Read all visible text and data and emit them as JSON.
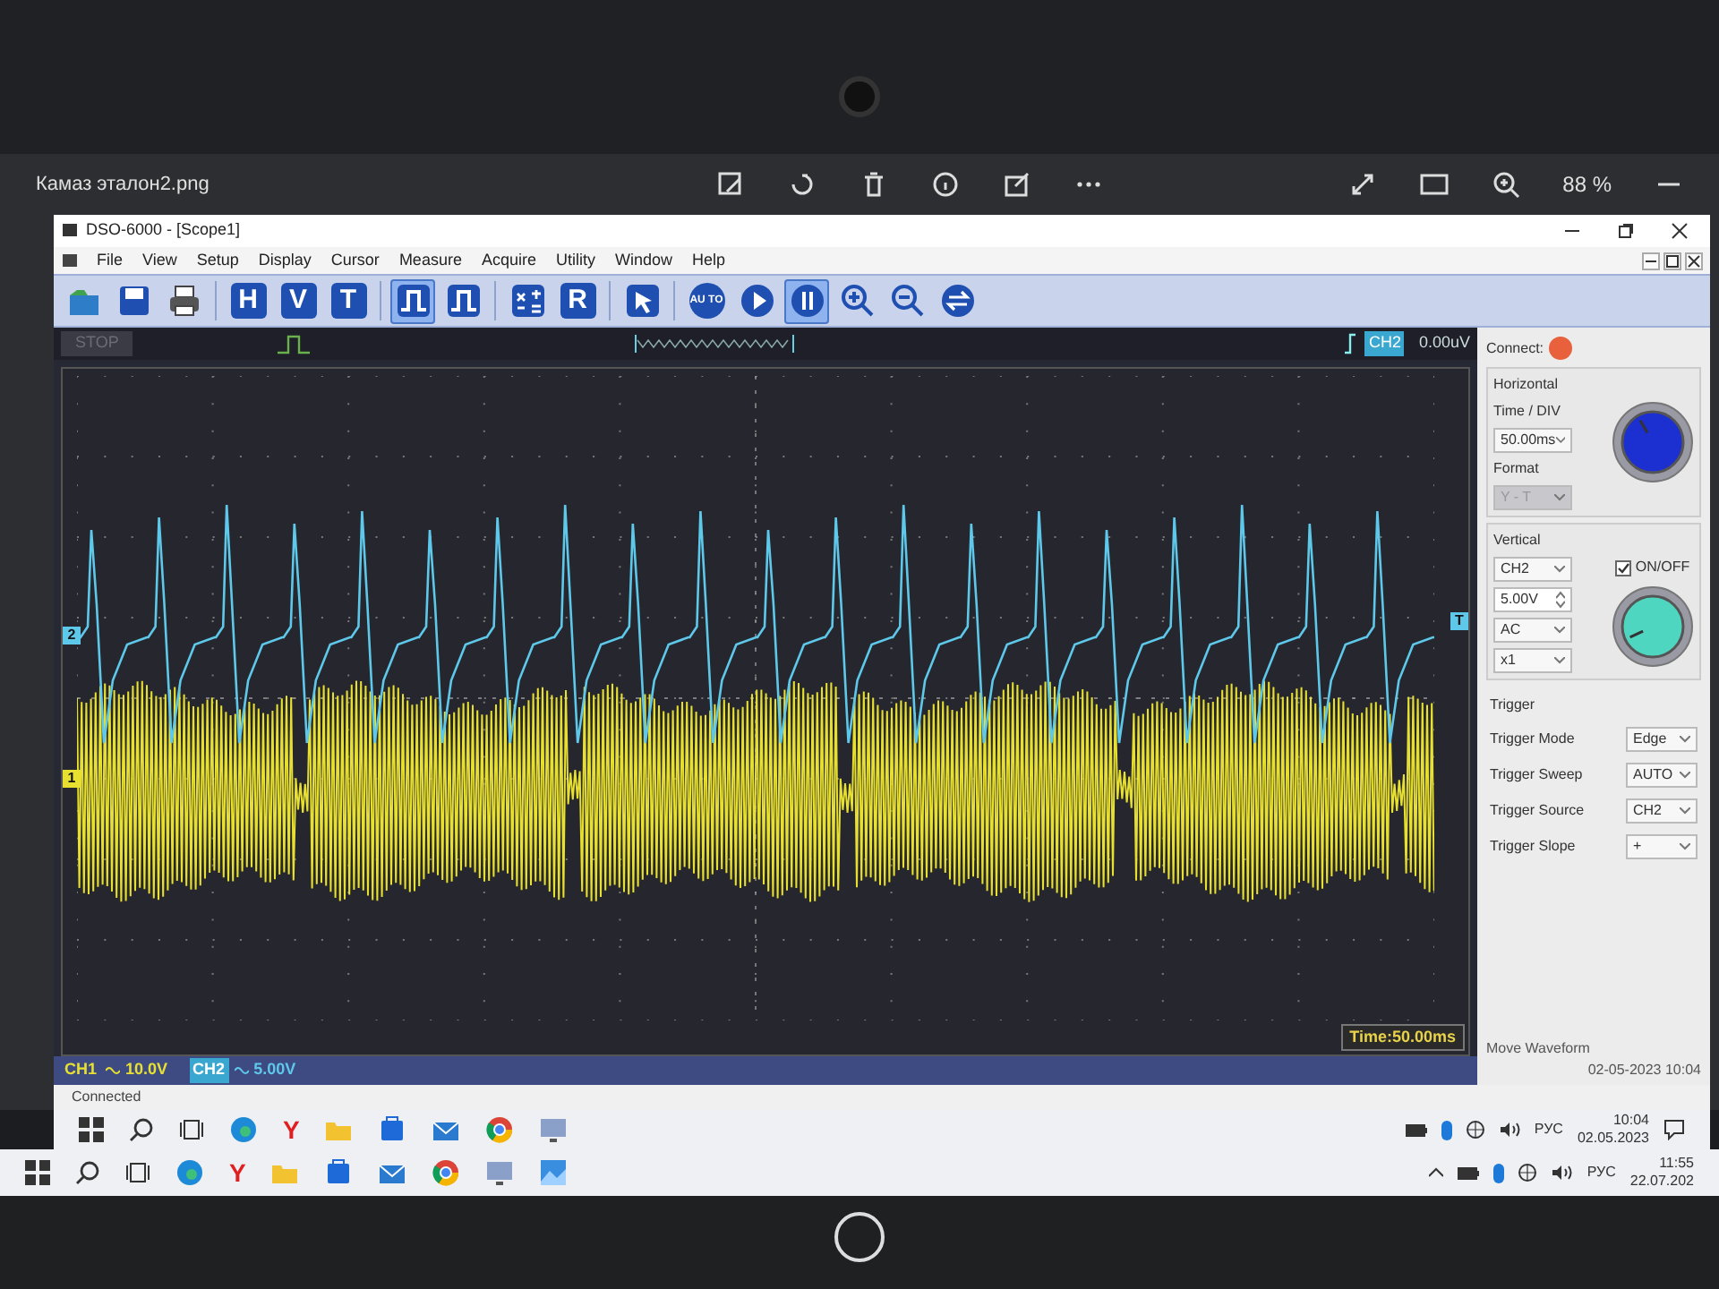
{
  "viewer": {
    "filename": "Камаз эталон2.png",
    "zoom": "88 %"
  },
  "window": {
    "title": "DSO-6000 - [Scope1]"
  },
  "menu": [
    "File",
    "View",
    "Setup",
    "Display",
    "Cursor",
    "Measure",
    "Acquire",
    "Utility",
    "Window",
    "Help"
  ],
  "toolbar": [
    {
      "kind": "open",
      "pressed": false
    },
    {
      "kind": "save",
      "pressed": false
    },
    {
      "kind": "print",
      "pressed": false
    },
    {
      "kind": "gap"
    },
    {
      "kind": "letter",
      "label": "H",
      "pressed": false
    },
    {
      "kind": "letter",
      "label": "V",
      "pressed": false
    },
    {
      "kind": "letter",
      "label": "T",
      "pressed": false
    },
    {
      "kind": "gap"
    },
    {
      "kind": "pulse",
      "pressed": true
    },
    {
      "kind": "pulse",
      "pressed": false
    },
    {
      "kind": "gap"
    },
    {
      "kind": "math",
      "pressed": false
    },
    {
      "kind": "letter",
      "label": "R",
      "pressed": false
    },
    {
      "kind": "gap"
    },
    {
      "kind": "pointer",
      "pressed": false
    },
    {
      "kind": "gap"
    },
    {
      "kind": "round",
      "label": "AU TO",
      "pressed": false
    },
    {
      "kind": "play",
      "pressed": false
    },
    {
      "kind": "pause",
      "pressed": true
    },
    {
      "kind": "zoomin",
      "pressed": false
    },
    {
      "kind": "zoomout",
      "pressed": false
    },
    {
      "kind": "swap",
      "pressed": false
    }
  ],
  "status_strip": {
    "run_state": "STOP",
    "trigger_channel": "CH2",
    "trigger_level": "0.00uV"
  },
  "scope": {
    "markers": [
      {
        "label": "2",
        "kind": "ch2"
      },
      {
        "label": "1",
        "kind": "ch1"
      },
      {
        "label": "T",
        "kind": "trigger"
      }
    ],
    "channels": [
      {
        "name": "CH1",
        "scale": "10.0V",
        "selected": false,
        "color": "#e8e030"
      },
      {
        "name": "CH2",
        "scale": "5.00V",
        "selected": true,
        "color": "#5ec8ea"
      }
    ],
    "timebase": "Time:50.00ms"
  },
  "panel": {
    "connect_label": "Connect:",
    "horizontal": {
      "title": "Horizontal",
      "time_div_label": "Time / DIV",
      "time_div": "50.00ms",
      "format_label": "Format",
      "format": "Y - T",
      "format_disabled": true
    },
    "vertical": {
      "title": "Vertical",
      "channel": "CH2",
      "on_off_label": "ON/OFF",
      "on_off_checked": true,
      "volts": "5.00V",
      "coupling": "AC",
      "probe": "x1"
    },
    "trigger": {
      "title": "Trigger",
      "rows": [
        {
          "label": "Trigger Mode",
          "value": "Edge"
        },
        {
          "label": "Trigger Sweep",
          "value": "AUTO"
        },
        {
          "label": "Trigger Source",
          "value": "CH2"
        },
        {
          "label": "Trigger Slope",
          "value": "+"
        }
      ]
    },
    "move_waveform": "Move Waveform",
    "datetime": "02-05-2023 10:04"
  },
  "status_bar": "Connected",
  "inner_taskbar": {
    "y_app": "Y",
    "lang": "РУС",
    "time": "10:04",
    "date": "02.05.2023"
  },
  "outer_taskbar": {
    "y_app": "Y",
    "lang": "РУС",
    "time": "11:55",
    "date": "22.07.202"
  }
}
